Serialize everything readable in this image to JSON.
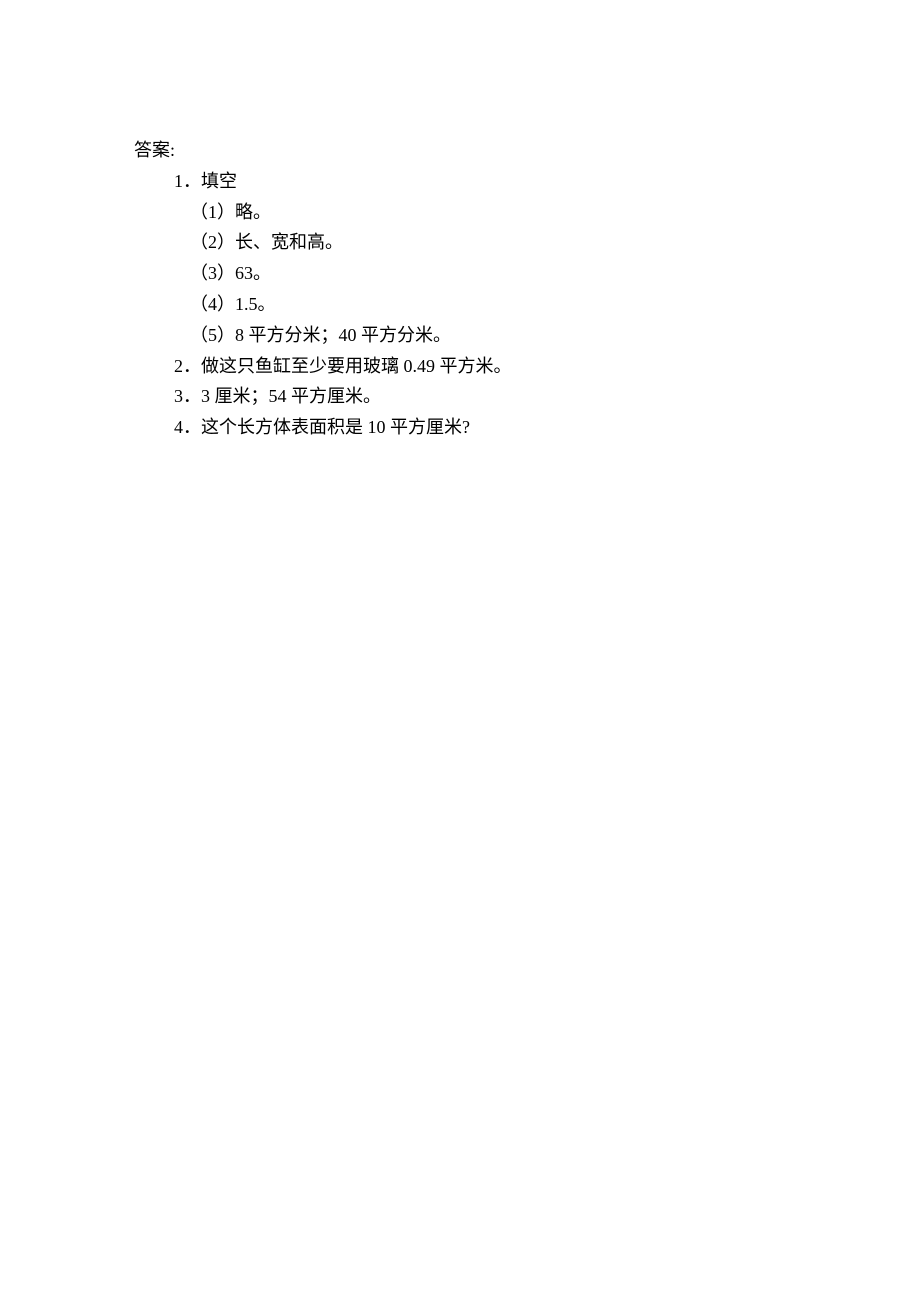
{
  "header": "答案:",
  "section1": {
    "title": "1．填空",
    "items": [
      "（1）略。",
      "（2）长、宽和高。",
      "（3）63。",
      "（4）1.5。",
      "（5）8 平方分米；40 平方分米。"
    ]
  },
  "section2": "2．做这只鱼缸至少要用玻璃 0.49 平方米。",
  "section3": "3．3 厘米；54 平方厘米。",
  "section4": "4．这个长方体表面积是 10 平方厘米?"
}
